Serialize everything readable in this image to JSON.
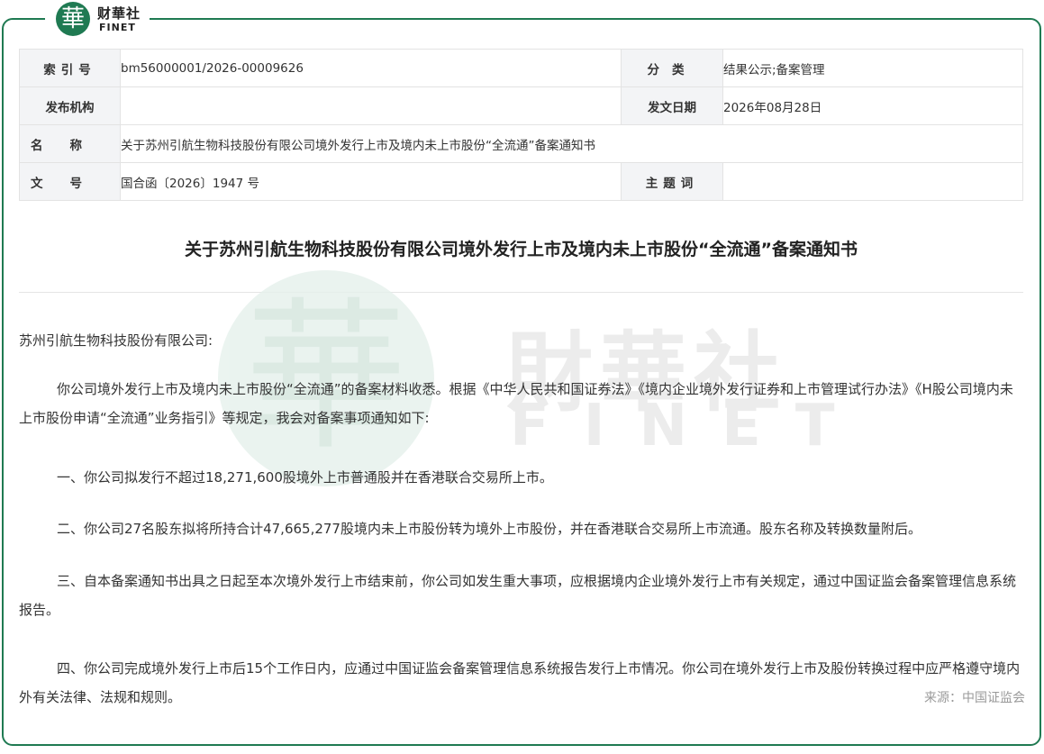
{
  "logo": {
    "glyph": "華",
    "cn": "财華社",
    "en": "FINET"
  },
  "meta": {
    "index_label": "索引号",
    "index_value": "bm56000001/2026-00009626",
    "category_label": "分类",
    "category_value": "结果公示;备案管理",
    "publisher_label": "发布机构",
    "publisher_value": "",
    "date_label": "发文日期",
    "date_value": "2026年08月28日",
    "name_label": "名称",
    "name_value": "关于苏州引航生物科技股份有限公司境外发行上市及境内未上市股份“全流通”备案通知书",
    "docno_label": "文号",
    "docno_value": "国合函〔2026〕1947 号",
    "subject_label": "主题词",
    "subject_value": ""
  },
  "title": "关于苏州引航生物科技股份有限公司境外发行上市及境内未上市股份“全流通”备案通知书",
  "watermark": {
    "glyph": "華",
    "cn": "財華社",
    "en": "FINET"
  },
  "body": {
    "salutation": "苏州引航生物科技股份有限公司:",
    "p1": "你公司境外发行上市及境内未上市股份“全流通”的备案材料收悉。根据《中华人民共和国证券法》《境内企业境外发行证券和上市管理试行办法》《H股公司境内未上市股份申请“全流通”业务指引》等规定，我会对备案事项通知如下:",
    "p2": "一、你公司拟发行不超过18,271,600股境外上市普通股并在香港联合交易所上市。",
    "p3": "二、你公司27名股东拟将所持合计47,665,277股境内未上市股份转为境外上市股份，并在香港联合交易所上市流通。股东名称及转换数量附后。",
    "p4": "三、自本备案通知书出具之日起至本次境外发行上市结束前，你公司如发生重大事项，应根据境内企业境外发行上市有关规定，通过中国证监会备案管理信息系统报告。",
    "p5": "四、你公司完成境外发行上市后15个工作日内，应通过中国证监会备案管理信息系统报告发行上市情况。你公司在境外发行上市及股份转换过程中应严格遵守境内外有关法律、法规和规则。"
  },
  "source": "来源：中国证监会",
  "colors": {
    "brand_green": "#1f7a52",
    "label_bg": "#f3f4f6"
  }
}
